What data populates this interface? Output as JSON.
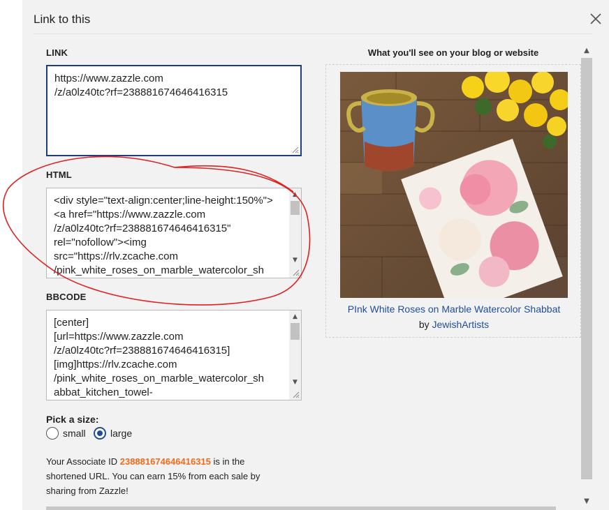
{
  "dialog": {
    "title": "Link to this"
  },
  "link": {
    "label": "LINK",
    "value": "https://www.zazzle.com\n/z/a0lz40tc?rf=238881674646416315"
  },
  "html": {
    "label": "HTML",
    "value": "<div style=\"text-align:center;line-height:150%\">\n<a href=\"https://www.zazzle.com\n/z/a0lz40tc?rf=238881674646416315\"\nrel=\"nofollow\"><img\nsrc=\"https://rlv.zcache.com\n/pink_white_roses_on_marble_watercolor_sh"
  },
  "bbcode": {
    "label": "BBCODE",
    "value": "[center]\n[url=https://www.zazzle.com\n/z/a0lz40tc?rf=238881674646416315]\n[img]https://rlv.zcache.com\n/pink_white_roses_on_marble_watercolor_sh\nabbat_kitchen_towel-"
  },
  "preview": {
    "heading": "What you'll see on your blog or website",
    "product_title": "PInk White Roses on Marble Watercolor Shabbat",
    "by_prefix": "by",
    "author": "JewishArtists"
  },
  "size": {
    "label": "Pick a size:",
    "options": [
      {
        "label": "small",
        "selected": false
      },
      {
        "label": "large",
        "selected": true
      }
    ]
  },
  "associate": {
    "prefix": "Your Associate ID",
    "id": "238881674646416315",
    "suffix": "is in the shortened URL. You can earn 15% from each sale by sharing from Zazzle!"
  },
  "colors": {
    "accent": "#1f4e9a",
    "associate_id": "#f26a1b",
    "annotation": "#e02020"
  }
}
